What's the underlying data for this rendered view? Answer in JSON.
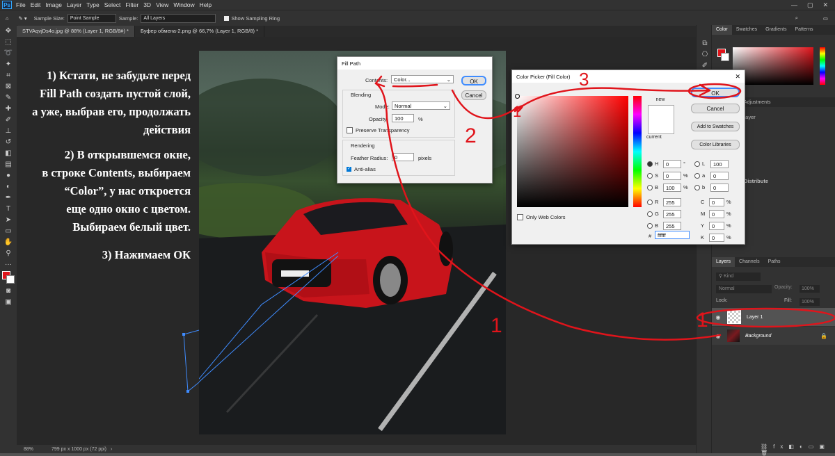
{
  "menu": {
    "items": [
      "File",
      "Edit",
      "Image",
      "Layer",
      "Type",
      "Select",
      "Filter",
      "3D",
      "View",
      "Window",
      "Help"
    ]
  },
  "options": {
    "sample_size_label": "Sample Size:",
    "sample_size_value": "Point Sample",
    "sample_label": "Sample:",
    "sample_value": "All Layers",
    "show_ring_label": "Show Sampling Ring"
  },
  "tabs": [
    {
      "label": "STVAqvjDs4o.jpg @ 88% (Layer 1, RGB/8#) *"
    },
    {
      "label": "Буфер обмена-2.png @ 66,7% (Layer 1, RGB/8) *"
    }
  ],
  "status": {
    "zoom": "88%",
    "doc_size": "799 px x 1000 px (72 ppi)"
  },
  "annotation": {
    "p1_l1": "1) Кстати, не забудьте перед",
    "p1_l2": "Fill Path создать пустой слой,",
    "p1_l3": "а уже, выбрав его, продолжать",
    "p1_l4": "действия",
    "p2_l1": "2) В открывшемся окне,",
    "p2_l2": "в строке Contents, выбираем",
    "p2_l3": "“Color”, у нас откроется",
    "p2_l4": "еще одно окно с цветом.",
    "p2_l5": "Выбираем белый цвет.",
    "p3": "3) Нажимаем ОК",
    "mark_1a": "1",
    "mark_1b": "1",
    "mark_2": "2",
    "mark_3": "3",
    "mark_1c": "1"
  },
  "fill_path": {
    "title": "Fill Path",
    "contents_label": "Contents:",
    "contents_value": "Color...",
    "ok": "OK",
    "cancel": "Cancel",
    "blending_label": "Blending",
    "mode_label": "Mode:",
    "mode_value": "Normal",
    "opacity_label": "Opacity:",
    "opacity_value": "100",
    "opacity_unit": "%",
    "preserve_label": "Preserve Transparency",
    "rendering_label": "Rendering",
    "feather_label": "Feather Radius:",
    "feather_value": "0",
    "feather_unit": "pixels",
    "antialias_label": "Anti-alias"
  },
  "color_picker": {
    "title": "Color Picker (Fill Color)",
    "ok": "OK",
    "cancel": "Cancel",
    "add_swatches": "Add to Swatches",
    "color_libraries": "Color Libraries",
    "new_label": "new",
    "current_label": "current",
    "only_web": "Only Web Colors",
    "fields": [
      {
        "name": "H",
        "value": "0",
        "unit": "°"
      },
      {
        "name": "S",
        "value": "0",
        "unit": "%"
      },
      {
        "name": "B",
        "value": "100",
        "unit": "%"
      },
      {
        "name": "R",
        "value": "255",
        "unit": ""
      },
      {
        "name": "G",
        "value": "255",
        "unit": ""
      },
      {
        "name": "B",
        "value": "255",
        "unit": ""
      }
    ],
    "lab": [
      {
        "name": "L",
        "value": "100"
      },
      {
        "name": "a",
        "value": "0"
      },
      {
        "name": "b",
        "value": "0"
      }
    ],
    "cmyk": [
      {
        "name": "C",
        "value": "0",
        "unit": "%"
      },
      {
        "name": "M",
        "value": "0",
        "unit": "%"
      },
      {
        "name": "Y",
        "value": "0",
        "unit": "%"
      },
      {
        "name": "K",
        "value": "0",
        "unit": "%"
      }
    ],
    "hex_label": "#",
    "hex_value": "ffffff"
  },
  "panels": {
    "color_tabs": [
      "Color",
      "Swatches",
      "Gradients",
      "Patterns"
    ],
    "adjust_tab": "Adjustments",
    "layer_label": "Layer",
    "distribute_label": "Distribute",
    "layers_tabs": [
      "Layers",
      "Channels",
      "Paths"
    ],
    "kind_label": "Kind",
    "blend_mode": "Normal",
    "opacity_label": "Opacity:",
    "opacity_value": "100%",
    "lock_label": "Lock:",
    "fill_label": "Fill:",
    "fill_value": "100%",
    "layers": [
      {
        "name": "Layer 1"
      },
      {
        "name": "Background"
      }
    ]
  },
  "colors": {
    "annotation_red": "#e0141b",
    "photoshop_blue": "#31a8ff"
  }
}
